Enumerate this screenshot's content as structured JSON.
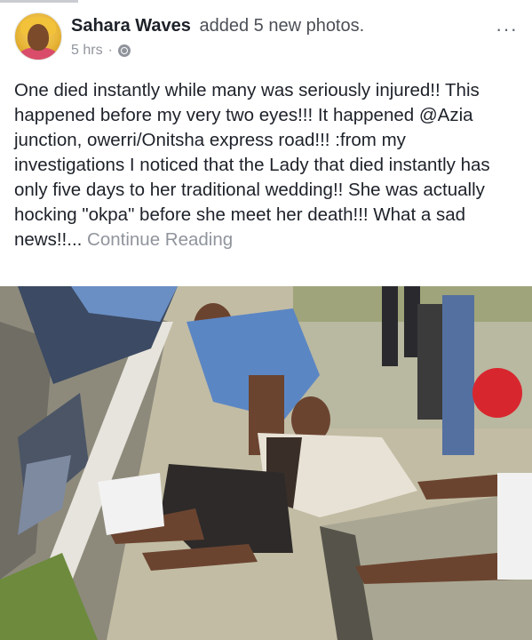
{
  "post": {
    "author": "Sahara Waves",
    "action": "added 5 new photos.",
    "time": "5 hrs",
    "separator": "·",
    "privacy_icon": "globe-icon",
    "menu_icon": "more-options-icon",
    "menu_glyph": "···",
    "body": "One died instantly while many was seriously injured!! This happened before my very two eyes!!! It happened @Azia junction, owerri/Onitsha express road!!! :from my investigations I noticed that the Lady that died instantly has only five days to her traditional wedding!!  She was actually hocking \"okpa\" before she meet her death!!! What a sad news!!...",
    "continue_label": "Continue Reading"
  },
  "colors": {
    "text_primary": "#1d2129",
    "text_secondary": "#90949c",
    "background": "#ffffff"
  }
}
